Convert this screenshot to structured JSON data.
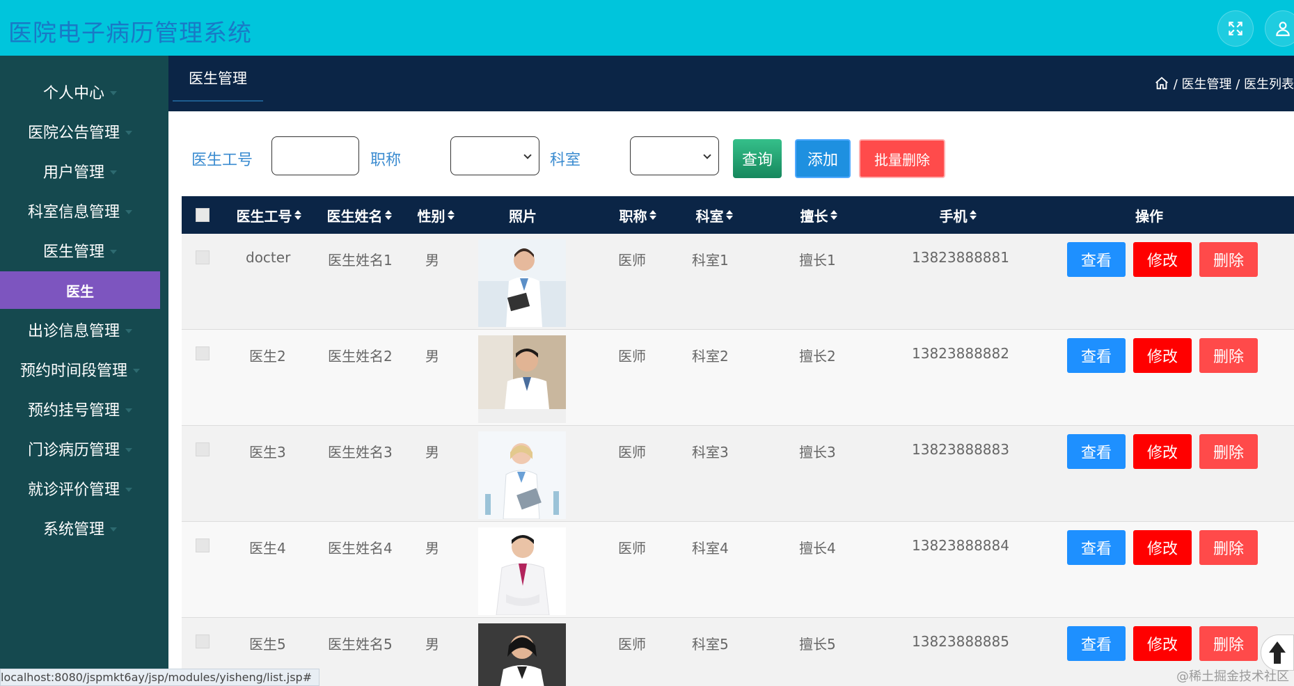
{
  "header": {
    "title": "医院电子病历管理系统",
    "icons": [
      "fullscreen-icon",
      "user-icon"
    ]
  },
  "sidebar": {
    "items": [
      {
        "label": "个人中心"
      },
      {
        "label": "医院公告管理"
      },
      {
        "label": "用户管理"
      },
      {
        "label": "科室信息管理"
      },
      {
        "label": "医生管理"
      },
      {
        "label": "医生",
        "active": true
      },
      {
        "label": "出诊信息管理"
      },
      {
        "label": "预约时间段管理"
      },
      {
        "label": "预约挂号管理"
      },
      {
        "label": "门诊病历管理"
      },
      {
        "label": "就诊评价管理"
      },
      {
        "label": "系统管理"
      }
    ]
  },
  "subbar": {
    "tab": "医生管理",
    "breadcrumb": "/ 医生管理 / 医生列表"
  },
  "search": {
    "doctor_id_label": "医生工号",
    "doctor_id_value": "",
    "title_label": "职称",
    "title_selected": "",
    "dept_label": "科室",
    "dept_selected": "",
    "query_button": "查询",
    "add_button": "添加",
    "batch_delete_button": "批量删除"
  },
  "colors": {
    "header_bg": "#00c5dc",
    "sidebar_bg": "#15494f",
    "active_item": "#7d55bf",
    "dark_bar": "#0b2546",
    "view_btn": "#1e90ff",
    "edit_btn": "#ff0000",
    "delete_btn": "#ff4a4a"
  },
  "table": {
    "columns": [
      "医生工号",
      "医生姓名",
      "性别",
      "照片",
      "职称",
      "科室",
      "擅长",
      "手机",
      "操作"
    ],
    "rows": [
      {
        "id": "docter",
        "name": "医生姓名1",
        "gender": "男",
        "title": "医师",
        "dept": "科室1",
        "specialty": "擅长1",
        "phone": "13823888881"
      },
      {
        "id": "医生2",
        "name": "医生姓名2",
        "gender": "男",
        "title": "医师",
        "dept": "科室2",
        "specialty": "擅长2",
        "phone": "13823888882"
      },
      {
        "id": "医生3",
        "name": "医生姓名3",
        "gender": "男",
        "title": "医师",
        "dept": "科室3",
        "specialty": "擅长3",
        "phone": "13823888883"
      },
      {
        "id": "医生4",
        "name": "医生姓名4",
        "gender": "男",
        "title": "医师",
        "dept": "科室4",
        "specialty": "擅长4",
        "phone": "13823888884"
      },
      {
        "id": "医生5",
        "name": "医生姓名5",
        "gender": "男",
        "title": "医师",
        "dept": "科室5",
        "specialty": "擅长5",
        "phone": "13823888885"
      }
    ],
    "actions": {
      "view": "查看",
      "edit": "修改",
      "delete": "删除"
    }
  },
  "status_url": "localhost:8080/jspmkt6ay/jsp/modules/yisheng/list.jsp#",
  "watermark": "@稀土掘金技术社区"
}
